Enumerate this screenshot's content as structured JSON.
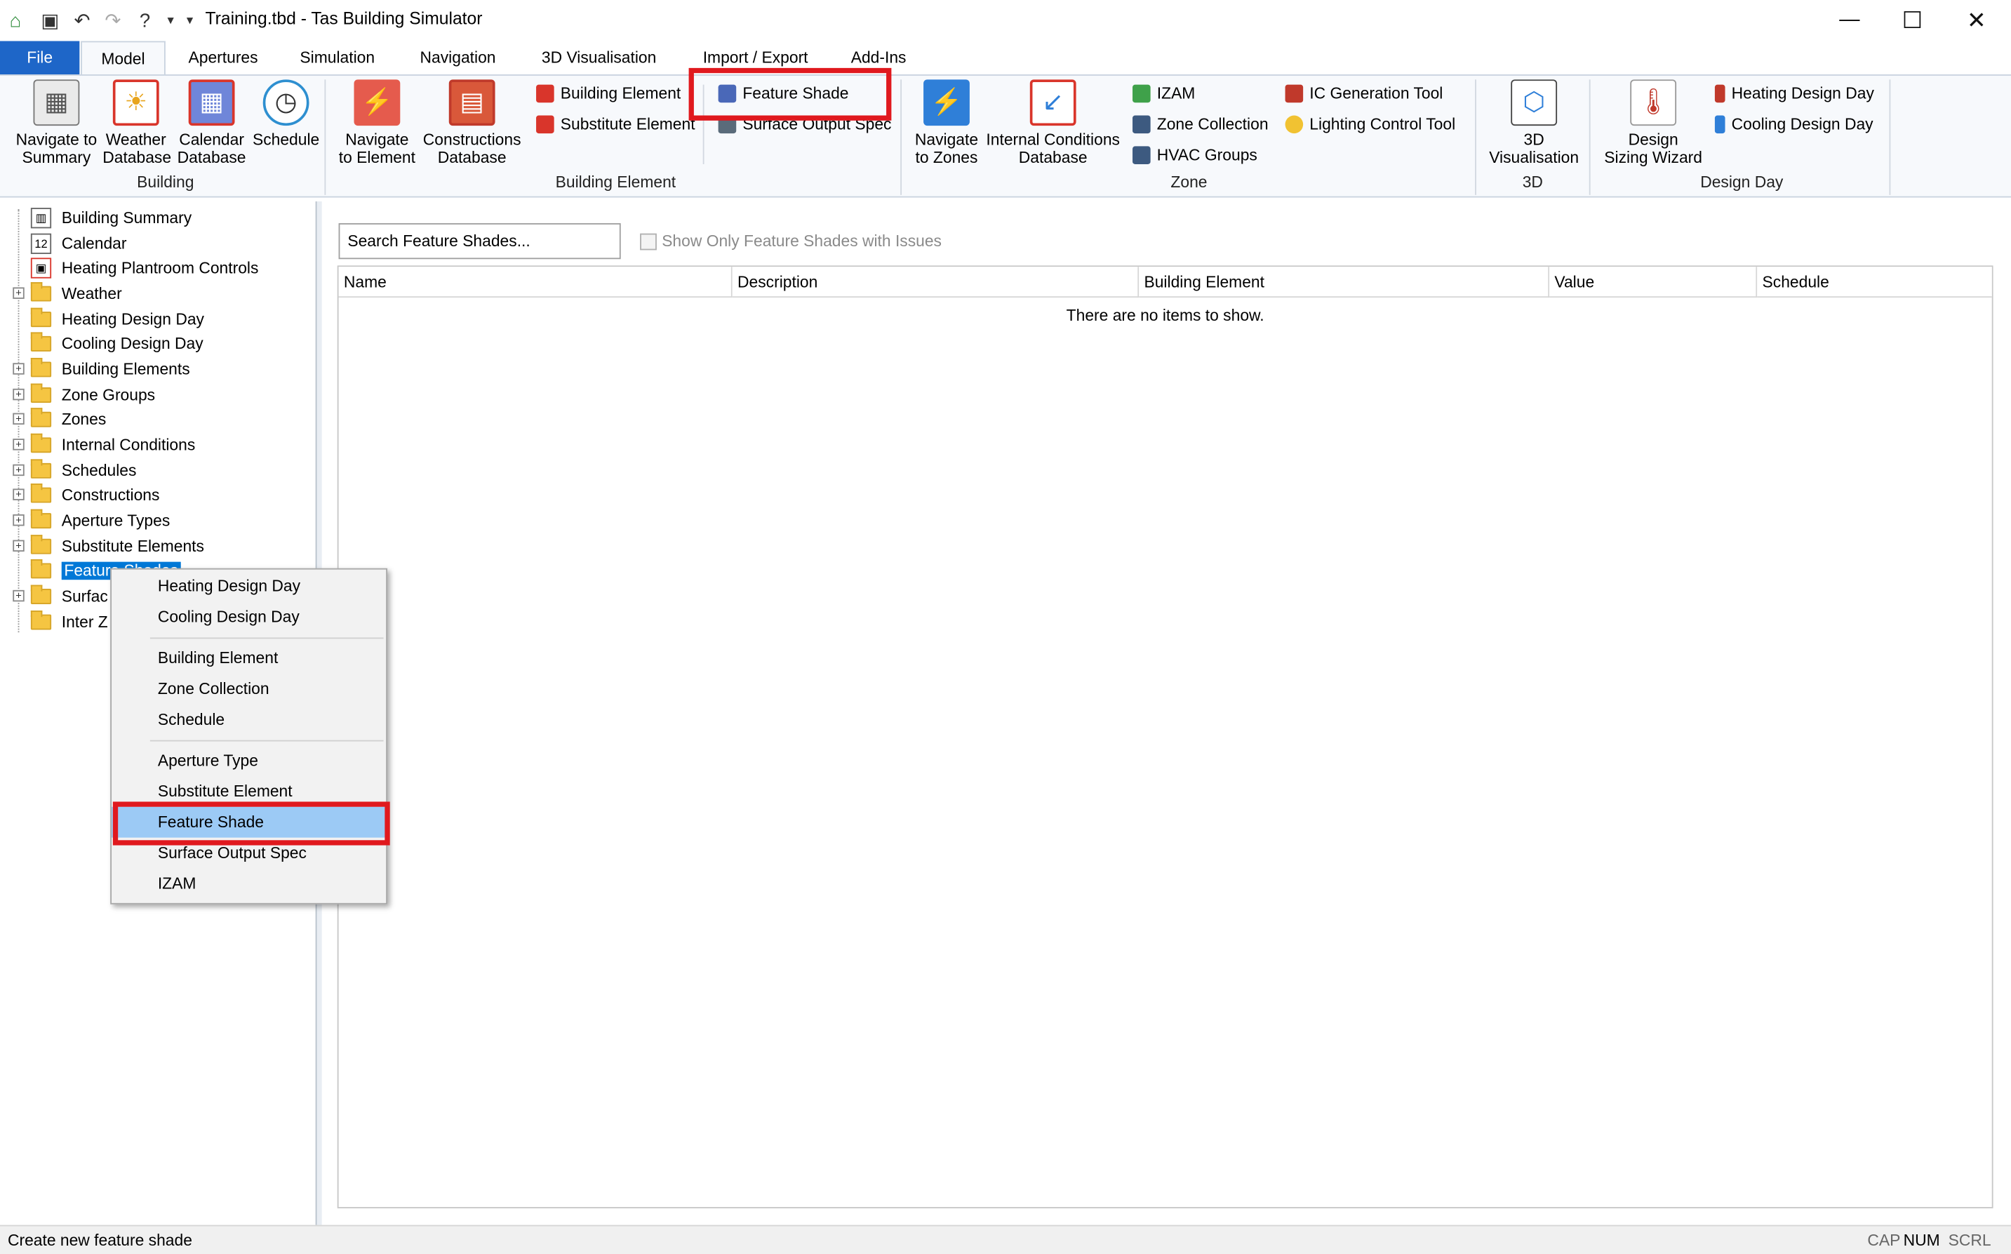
{
  "window": {
    "title": "Training.tbd - Tas Building Simulator",
    "controls": {
      "minimize": "—",
      "maximize": "☐",
      "close": "✕"
    }
  },
  "tabs": [
    "File",
    "Model",
    "Apertures",
    "Simulation",
    "Navigation",
    "3D Visualisation",
    "Import / Export",
    "Add-Ins"
  ],
  "ribbon": {
    "building": {
      "label": "Building",
      "buttons": [
        {
          "l1": "Navigate to",
          "l2": "Summary"
        },
        {
          "l1": "Weather",
          "l2": "Database"
        },
        {
          "l1": "Calendar",
          "l2": "Database"
        },
        {
          "l1": "Schedule",
          "l2": ""
        }
      ]
    },
    "building_element": {
      "label": "Building Element",
      "buttons": [
        {
          "l1": "Navigate",
          "l2": "to Element"
        },
        {
          "l1": "Constructions",
          "l2": "Database"
        }
      ],
      "small": [
        "Building Element",
        "Substitute Element",
        "Feature Shade",
        "Surface Output Spec"
      ]
    },
    "zone": {
      "label": "Zone",
      "buttons": [
        {
          "l1": "Navigate",
          "l2": "to Zones"
        },
        {
          "l1": "Internal Conditions",
          "l2": "Database"
        }
      ],
      "small": [
        "IZAM",
        "Zone Collection",
        "HVAC Groups",
        "IC Generation Tool",
        "Lighting Control Tool"
      ]
    },
    "three_d": {
      "label": "3D",
      "buttons": [
        {
          "l1": "3D",
          "l2": "Visualisation"
        }
      ]
    },
    "design_day": {
      "label": "Design Day",
      "buttons": [
        {
          "l1": "Design",
          "l2": "Sizing Wizard"
        }
      ],
      "small": [
        "Heating Design Day",
        "Cooling Design Day"
      ]
    }
  },
  "tree": {
    "items": [
      "Building Summary",
      "Calendar",
      "Heating Plantroom Controls",
      "Weather",
      "Heating Design Day",
      "Cooling Design Day",
      "Building Elements",
      "Zone Groups",
      "Zones",
      "Internal Conditions",
      "Schedules",
      "Constructions",
      "Aperture Types",
      "Substitute Elements",
      "Feature Shades",
      "Surfac",
      "Inter Z"
    ],
    "selected_visible": "Feature Shades"
  },
  "main": {
    "search_placeholder": "Search Feature Shades...",
    "filter_label": "Show Only Feature Shades with Issues",
    "columns": [
      "Name",
      "Description",
      "Building Element",
      "Value",
      "Schedule"
    ],
    "empty_message": "There are no items to show."
  },
  "context_menu": {
    "items": [
      "Heating Design Day",
      "Cooling Design Day",
      "Building Element",
      "Zone Collection",
      "Schedule",
      "Aperture Type",
      "Substitute Element",
      "Feature Shade",
      "Surface Output Spec",
      "IZAM"
    ]
  },
  "status": {
    "text": "Create new feature shade",
    "indicators": [
      "CAP",
      "NUM",
      "SCRL"
    ]
  },
  "colors": {
    "accent": "#1e66c8",
    "highlight": "#e0191e",
    "menu_selected": "#9ccaf5"
  }
}
